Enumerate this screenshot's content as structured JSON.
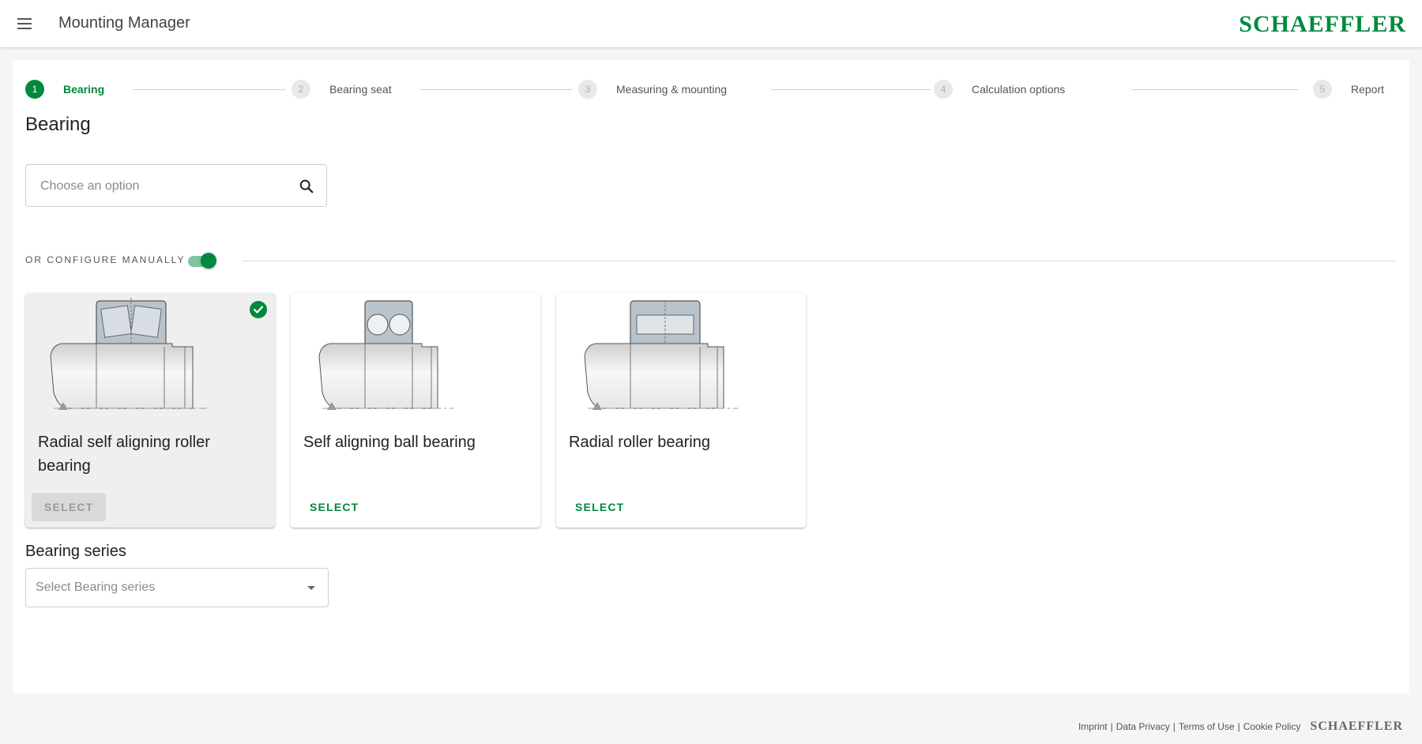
{
  "header": {
    "menu_icon": "hamburger-menu-icon",
    "title": "Mounting Manager",
    "logo": "SCHAEFFLER",
    "brand_color": "#00893d"
  },
  "stepper": {
    "steps": [
      {
        "number": "1",
        "label": "Bearing",
        "active": true
      },
      {
        "number": "2",
        "label": "Bearing seat",
        "active": false
      },
      {
        "number": "3",
        "label": "Measuring & mounting",
        "active": false
      },
      {
        "number": "4",
        "label": "Calculation options",
        "active": false
      },
      {
        "number": "5",
        "label": "Report",
        "active": false
      }
    ]
  },
  "bearing": {
    "title": "Bearing",
    "search_placeholder": "Choose an option",
    "search_icon": "search-icon",
    "manual_label": "OR CONFIGURE MANUALLY",
    "manual_toggle_on": true
  },
  "cards": [
    {
      "title": "Radial self aligning roller bearing",
      "button": "SELECT",
      "selected": true,
      "image": "spherical-roller-bearing-icon"
    },
    {
      "title": "Self aligning ball bearing",
      "button": "SELECT",
      "selected": false,
      "image": "self-aligning-ball-bearing-icon"
    },
    {
      "title": "Radial roller bearing",
      "button": "SELECT",
      "selected": false,
      "image": "cylindrical-roller-bearing-icon"
    }
  ],
  "series": {
    "title": "Bearing series",
    "placeholder": "Select Bearing series"
  },
  "footer": {
    "links": [
      "Imprint",
      "Data Privacy",
      "Terms of Use",
      "Cookie Policy"
    ],
    "separator": "|",
    "logo": "SCHAEFFLER"
  }
}
